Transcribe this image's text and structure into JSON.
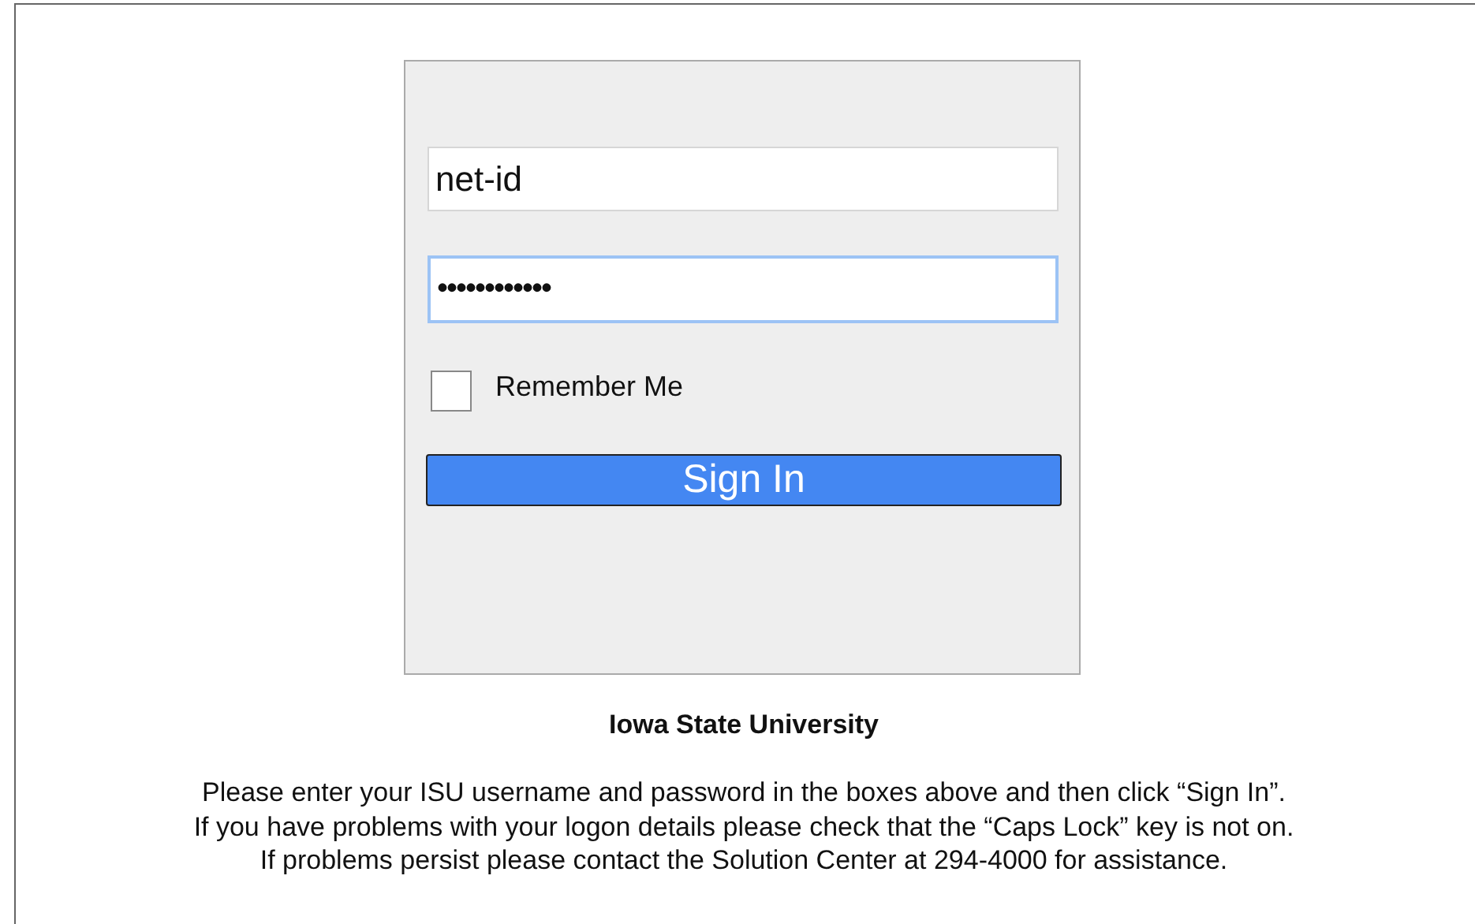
{
  "login_panel": {
    "fields": [
      {
        "kind": "text",
        "value": "net-id",
        "focused": false
      },
      {
        "kind": "password",
        "value": "••••••••••••",
        "focused": true
      }
    ],
    "remember_me": {
      "label": "Remember Me",
      "checked": false
    },
    "sign_in_button": "Sign In"
  },
  "institution": "Iowa State University",
  "instructions": [
    "Please enter your ISU username and password in the boxes above and then click “Sign In”.",
    "If you have problems with your logon details please check that the “Caps Lock” key is not on.",
    "If problems persist please contact the Solution Center at 294-4000 for assistance."
  ]
}
